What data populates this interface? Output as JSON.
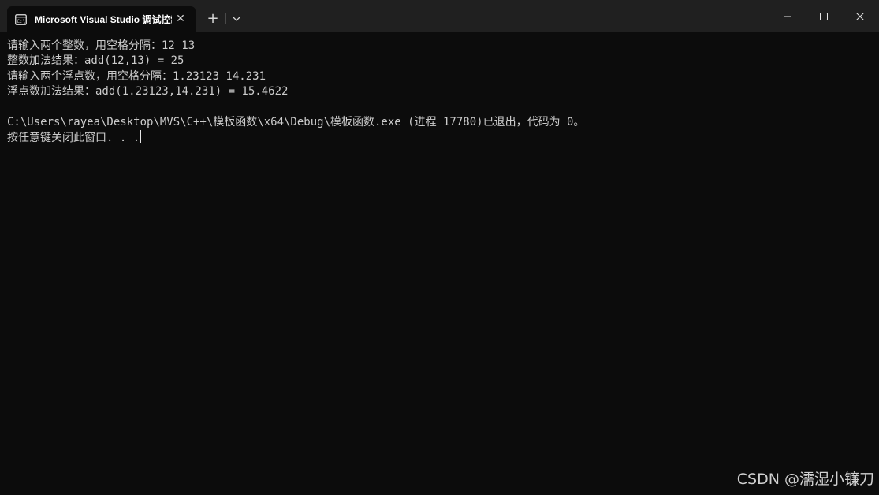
{
  "window": {
    "tab_title": "Microsoft Visual Studio 调试控制台",
    "tab_close_symbol": "✕",
    "new_tab_symbol": "+",
    "icons": {
      "tab": "terminal-icon",
      "close_tab": "close-icon",
      "new_tab": "plus-icon",
      "dropdown": "chevron-down-icon",
      "minimize": "minimize-icon",
      "maximize": "maximize-icon",
      "close": "close-icon"
    }
  },
  "console": {
    "lines": [
      "请输入两个整数，用空格分隔：12 13",
      "整数加法结果：add(12,13) = 25",
      "请输入两个浮点数，用空格分隔：1.23123 14.231",
      "浮点数加法结果：add(1.23123,14.231) = 15.4622",
      "C:\\Users\\rayea\\Desktop\\MVS\\C++\\模板函数\\x64\\Debug\\模板函数.exe (进程 17780)已退出，代码为 0。",
      "按任意键关闭此窗口. . ."
    ]
  },
  "watermark": "CSDN @濡湿小镰刀",
  "colors": {
    "background": "#0c0c0c",
    "titlebar": "#202020",
    "text": "#cccccc"
  }
}
